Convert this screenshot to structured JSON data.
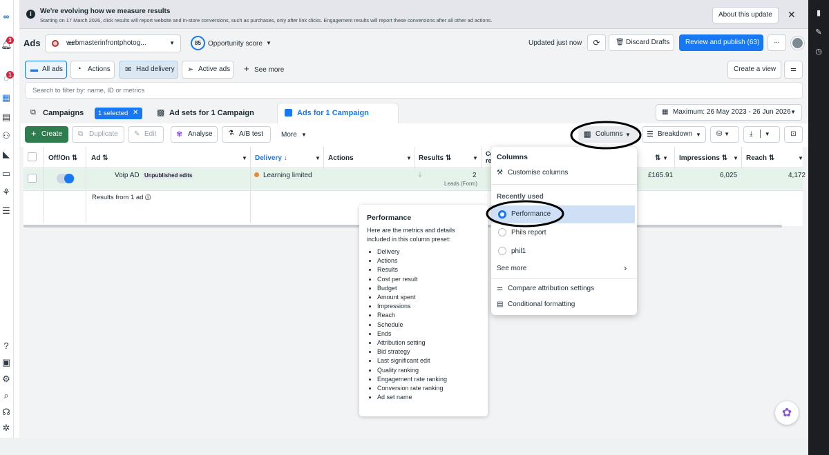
{
  "banner": {
    "title": "We're evolving how we measure results",
    "text": "Starting on 17 March 2026, click results will report website and in-store conversions, such as purchases, only after link clicks. Engagement results will report these conversions after all other ad actions.",
    "about_btn": "About this update"
  },
  "leftnav": {
    "notif_badge": "3",
    "msg_badge": "1"
  },
  "header": {
    "title": "Ads",
    "account": "webmasterinfrontphotog...",
    "score_value": "85",
    "score_label": "Opportunity score",
    "updated": "Updated just now",
    "discard": "Discard Drafts",
    "review": "Review and publish (63)",
    "more": "..."
  },
  "filters": {
    "all_ads": "All ads",
    "actions": "Actions",
    "had_delivery": "Had delivery",
    "active_ads": "Active ads",
    "see_more": "See more",
    "create_view": "Create a view",
    "search_placeholder": "Search to filter by: name, ID or metrics"
  },
  "tabs": {
    "campaigns": "Campaigns",
    "selected": "1 selected",
    "adsets": "Ad sets for 1 Campaign",
    "ads": "Ads for 1 Campaign",
    "date_range": "Maximum: 26 May 2023 - 26 Jun 2026"
  },
  "toolbar": {
    "create": "Create",
    "duplicate": "Duplicate",
    "edit": "Edit",
    "analyse": "Analyse",
    "ab_test": "A/B test",
    "more": "More",
    "columns": "Columns",
    "breakdown": "Breakdown"
  },
  "table": {
    "headers": {
      "offon": "Off/On",
      "ad": "Ad",
      "delivery": "Delivery",
      "actions": "Actions",
      "results": "Results",
      "cost_partial": "Co re",
      "amount": "",
      "impressions": "Impressions",
      "reach": "Reach"
    },
    "row": {
      "ad_name": "Voip AD",
      "unpublished": "Unpublished edits",
      "delivery": "Learning limited",
      "results_value": "2",
      "results_type": "Leads (Form)",
      "amount": "£165.91",
      "impressions": "6,025",
      "reach": "4,172"
    },
    "footer": "Results from 1 ad"
  },
  "columns_menu": {
    "heading": "Columns",
    "customise": "Customise columns",
    "recently_used": "Recently used",
    "options": [
      "Performance",
      "Phils report",
      "phil1"
    ],
    "selected": "Performance",
    "see_more": "See more",
    "compare": "Compare attribution settings",
    "conditional": "Conditional formatting"
  },
  "tooltip": {
    "title": "Performance",
    "desc": "Here are the metrics and details included in this column preset:",
    "items": [
      "Delivery",
      "Actions",
      "Results",
      "Cost per result",
      "Budget",
      "Amount spent",
      "Impressions",
      "Reach",
      "Schedule",
      "Ends",
      "Attribution setting",
      "Bid strategy",
      "Last significant edit",
      "Quality ranking",
      "Engagement rate ranking",
      "Conversion rate ranking",
      "Ad set name"
    ]
  },
  "colors": {
    "accent": "#1877f2",
    "create_green": "#2f7d4f",
    "row_highlight": "#e6f3ea",
    "learning_dot": "#e8883a"
  }
}
